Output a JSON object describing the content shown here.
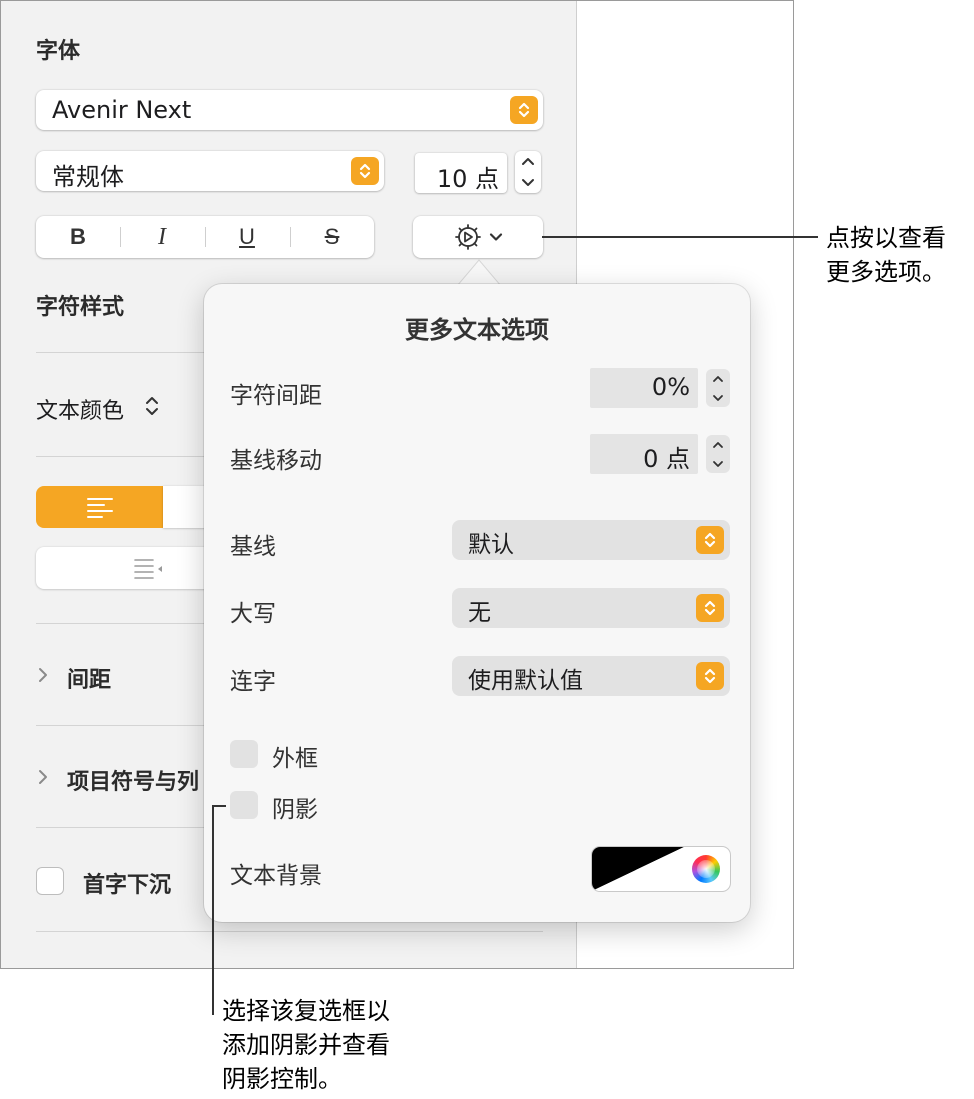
{
  "sidebar": {
    "font_section": {
      "title": "字体",
      "family": "Avenir Next",
      "typeface": "常规体",
      "size": "10 点",
      "styles": {
        "bold": "B",
        "italic": "I",
        "underline": "U",
        "strikethrough": "S"
      }
    },
    "character_styles_label": "字符样式",
    "text_color_label": "文本颜色",
    "text_color_chevron": "⌃⌄",
    "spacing_label": "间距",
    "bullets_label": "项目符号与列",
    "drop_cap_label": "首字下沉"
  },
  "popover": {
    "title": "更多文本选项",
    "character_spacing": {
      "label": "字符间距",
      "value": "0%"
    },
    "baseline_shift": {
      "label": "基线移动",
      "value": "0 点"
    },
    "baseline": {
      "label": "基线",
      "value": "默认"
    },
    "capitalization": {
      "label": "大写",
      "value": "无"
    },
    "ligatures": {
      "label": "连字",
      "value": "使用默认值"
    },
    "outline": {
      "label": "外框",
      "checked": false
    },
    "shadow": {
      "label": "阴影",
      "checked": false
    },
    "text_background": {
      "label": "文本背景",
      "color": "#000000"
    }
  },
  "callouts": {
    "gear": [
      "点按以查看",
      "更多选项。"
    ],
    "shadow": [
      "选择该复选框以",
      "添加阴影并查看",
      "阴影控制。"
    ]
  },
  "colors": {
    "accent": "#f5a623",
    "sidebar_bg": "#f2f2f2",
    "popover_bg": "#f7f7f7"
  }
}
